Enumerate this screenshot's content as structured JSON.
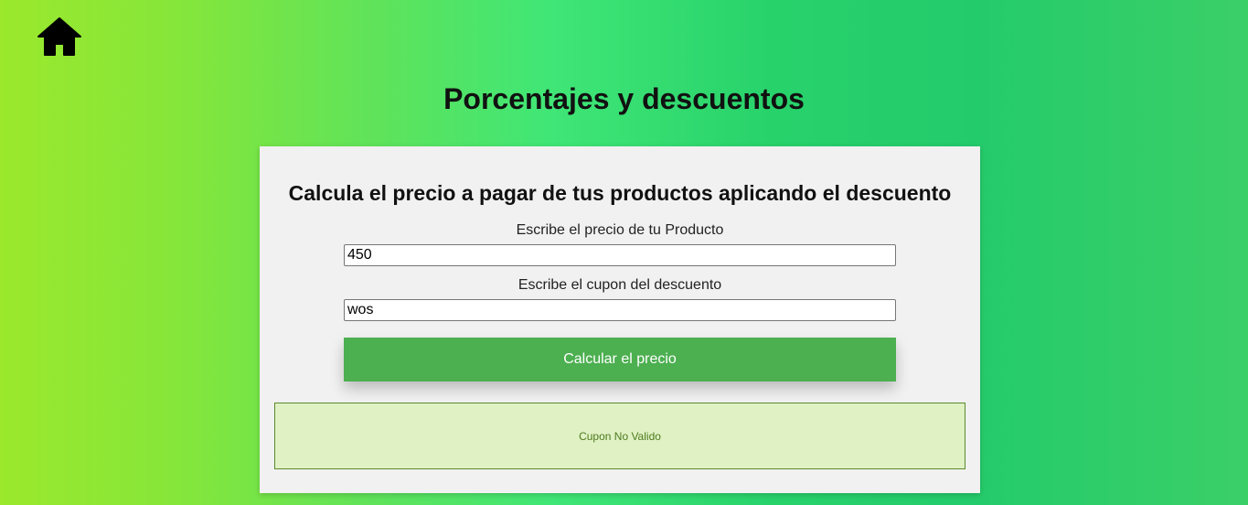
{
  "nav": {
    "home_icon": "home-icon"
  },
  "header": {
    "title": "Porcentajes y descuentos"
  },
  "card": {
    "title": "Calcula el precio a pagar de tus productos aplicando el descuento",
    "price_label": "Escribe el precio de tu Producto",
    "price_value": "450",
    "coupon_label": "Escribe el cupon del descuento",
    "coupon_value": "wos",
    "calculate_button": "Calcular el precio",
    "result_text": "Cupon No Valido"
  },
  "colors": {
    "button": "#4caf50",
    "result_background": "#e0f1c4",
    "result_text": "#4d7a1f",
    "card_background": "#f1f1f1"
  }
}
